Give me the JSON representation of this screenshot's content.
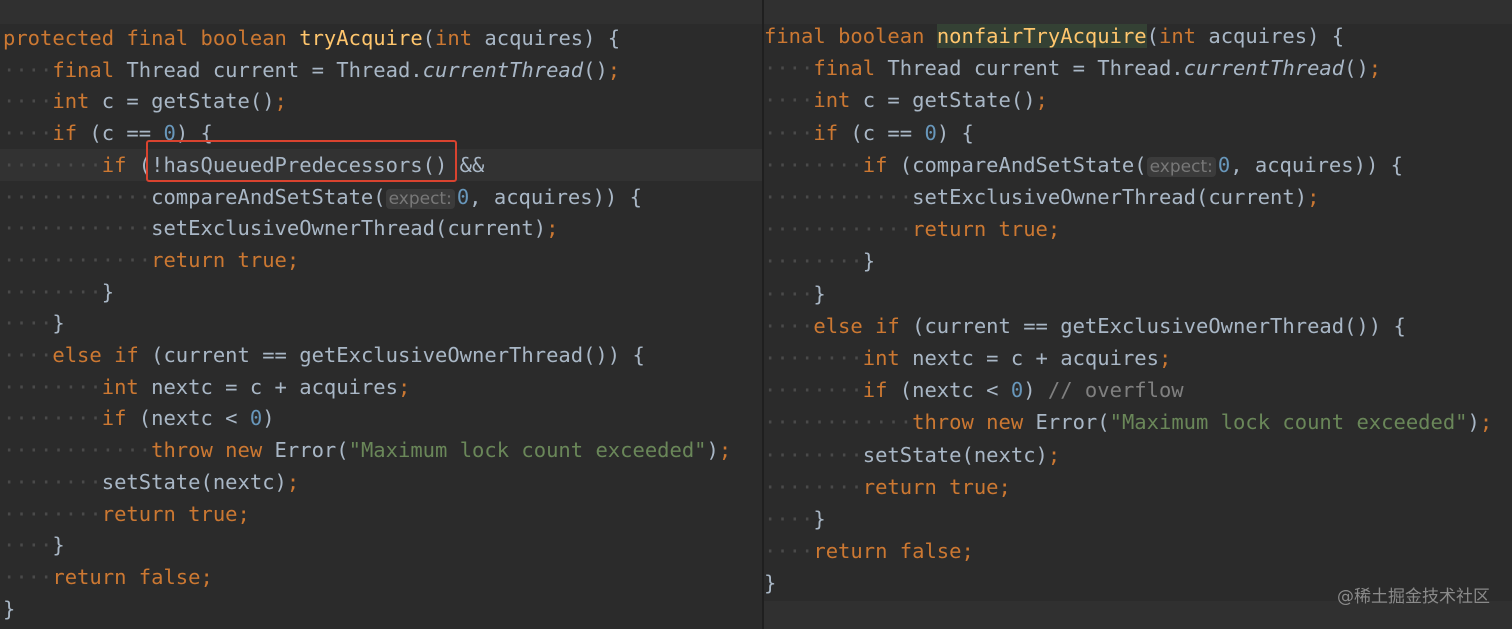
{
  "left_pane": {
    "lines": [
      {
        "ind": "",
        "tokens": [
          {
            "t": "protected",
            "c": "kw"
          },
          {
            "t": " "
          },
          {
            "t": "final",
            "c": "kw"
          },
          {
            "t": " "
          },
          {
            "t": "boolean",
            "c": "kw"
          },
          {
            "t": " "
          },
          {
            "t": "tryAcquire",
            "c": "fn"
          },
          {
            "t": "("
          },
          {
            "t": "int",
            "c": "kw"
          },
          {
            "t": " acquires) {"
          }
        ]
      },
      {
        "ind": "····",
        "tokens": [
          {
            "t": "final",
            "c": "kw"
          },
          {
            "t": " Thread current = Thread."
          },
          {
            "t": "currentThread",
            "c": "it"
          },
          {
            "t": "()"
          },
          {
            "t": ";",
            "c": "kw"
          }
        ]
      },
      {
        "ind": "····",
        "tokens": [
          {
            "t": "int",
            "c": "kw"
          },
          {
            "t": " c = getState()"
          },
          {
            "t": ";",
            "c": "kw"
          }
        ]
      },
      {
        "ind": "····",
        "tokens": [
          {
            "t": "if",
            "c": "kw"
          },
          {
            "t": " (c == "
          },
          {
            "t": "0",
            "c": "num"
          },
          {
            "t": ") {"
          }
        ]
      },
      {
        "ind": "········",
        "hl": true,
        "tokens": [
          {
            "t": "if",
            "c": "kw"
          },
          {
            "t": " ("
          },
          {
            "t": "!hasQueuedPredecessors"
          },
          {
            "t": "() &&"
          }
        ]
      },
      {
        "ind": "············",
        "tokens": [
          {
            "t": "compareAndSetState("
          },
          {
            "t": "expect:",
            "c": "hint"
          },
          {
            "t": "0",
            "c": "num"
          },
          {
            "t": ", acquires)) {"
          }
        ]
      },
      {
        "ind": "············",
        "tokens": [
          {
            "t": "setExclusiveOwnerThread(current)"
          },
          {
            "t": ";",
            "c": "kw"
          }
        ]
      },
      {
        "ind": "············",
        "tokens": [
          {
            "t": "return",
            "c": "kw"
          },
          {
            "t": " "
          },
          {
            "t": "true",
            "c": "kw"
          },
          {
            "t": ";",
            "c": "kw"
          }
        ]
      },
      {
        "ind": "········",
        "tokens": [
          {
            "t": "}"
          }
        ]
      },
      {
        "ind": "····",
        "tokens": [
          {
            "t": "}"
          }
        ]
      },
      {
        "ind": "····",
        "tokens": [
          {
            "t": "else",
            "c": "kw"
          },
          {
            "t": " "
          },
          {
            "t": "if",
            "c": "kw"
          },
          {
            "t": " (current == getExclusiveOwnerThread()) {"
          }
        ]
      },
      {
        "ind": "········",
        "tokens": [
          {
            "t": "int",
            "c": "kw"
          },
          {
            "t": " nextc = c + acquires"
          },
          {
            "t": ";",
            "c": "kw"
          }
        ]
      },
      {
        "ind": "········",
        "tokens": [
          {
            "t": "if",
            "c": "kw"
          },
          {
            "t": " (nextc < "
          },
          {
            "t": "0",
            "c": "num"
          },
          {
            "t": ")"
          }
        ]
      },
      {
        "ind": "············",
        "tokens": [
          {
            "t": "throw",
            "c": "kw"
          },
          {
            "t": " "
          },
          {
            "t": "new",
            "c": "kw"
          },
          {
            "t": " Error("
          },
          {
            "t": "\"Maximum lock count exceeded\"",
            "c": "str"
          },
          {
            "t": ")"
          },
          {
            "t": ";",
            "c": "kw"
          }
        ]
      },
      {
        "ind": "········",
        "tokens": [
          {
            "t": "setState(nextc)"
          },
          {
            "t": ";",
            "c": "kw"
          }
        ]
      },
      {
        "ind": "········",
        "tokens": [
          {
            "t": "return",
            "c": "kw"
          },
          {
            "t": " "
          },
          {
            "t": "true",
            "c": "kw"
          },
          {
            "t": ";",
            "c": "kw"
          }
        ]
      },
      {
        "ind": "····",
        "tokens": [
          {
            "t": "}"
          }
        ]
      },
      {
        "ind": "····",
        "tokens": [
          {
            "t": "return",
            "c": "kw"
          },
          {
            "t": " "
          },
          {
            "t": "false",
            "c": "kw"
          },
          {
            "t": ";",
            "c": "kw"
          }
        ]
      },
      {
        "ind": "",
        "tokens": [
          {
            "t": "}"
          }
        ]
      }
    ]
  },
  "right_pane": {
    "lines": [
      {
        "ind": "",
        "tokens": [
          {
            "t": "final",
            "c": "kw"
          },
          {
            "t": " "
          },
          {
            "t": "boolean",
            "c": "kw"
          },
          {
            "t": " "
          },
          {
            "t": "nonfairTryAcquire",
            "c": "fnhl"
          },
          {
            "t": "("
          },
          {
            "t": "int",
            "c": "kw"
          },
          {
            "t": " acquires) {"
          }
        ]
      },
      {
        "ind": "····",
        "tokens": [
          {
            "t": "final",
            "c": "kw"
          },
          {
            "t": " Thread current = Thread."
          },
          {
            "t": "currentThread",
            "c": "it"
          },
          {
            "t": "()"
          },
          {
            "t": ";",
            "c": "kw"
          }
        ]
      },
      {
        "ind": "····",
        "tokens": [
          {
            "t": "int",
            "c": "kw"
          },
          {
            "t": " c = getState()"
          },
          {
            "t": ";",
            "c": "kw"
          }
        ]
      },
      {
        "ind": "····",
        "tokens": [
          {
            "t": "if",
            "c": "kw"
          },
          {
            "t": " (c == "
          },
          {
            "t": "0",
            "c": "num"
          },
          {
            "t": ") {"
          }
        ]
      },
      {
        "ind": "········",
        "tokens": [
          {
            "t": "if",
            "c": "kw"
          },
          {
            "t": " (compareAndSetState("
          },
          {
            "t": "expect:",
            "c": "hint"
          },
          {
            "t": "0",
            "c": "num"
          },
          {
            "t": ", acquires)) {"
          }
        ]
      },
      {
        "ind": "············",
        "tokens": [
          {
            "t": "setExclusiveOwnerThread(current)"
          },
          {
            "t": ";",
            "c": "kw"
          }
        ]
      },
      {
        "ind": "············",
        "tokens": [
          {
            "t": "return",
            "c": "kw"
          },
          {
            "t": " "
          },
          {
            "t": "true",
            "c": "kw"
          },
          {
            "t": ";",
            "c": "kw"
          }
        ]
      },
      {
        "ind": "········",
        "tokens": [
          {
            "t": "}"
          }
        ]
      },
      {
        "ind": "····",
        "tokens": [
          {
            "t": "}"
          }
        ]
      },
      {
        "ind": "····",
        "tokens": [
          {
            "t": "else",
            "c": "kw"
          },
          {
            "t": " "
          },
          {
            "t": "if",
            "c": "kw"
          },
          {
            "t": " (current == getExclusiveOwnerThread()) {"
          }
        ]
      },
      {
        "ind": "········",
        "tokens": [
          {
            "t": "int",
            "c": "kw"
          },
          {
            "t": " nextc = c + acquires"
          },
          {
            "t": ";",
            "c": "kw"
          }
        ]
      },
      {
        "ind": "········",
        "tokens": [
          {
            "t": "if",
            "c": "kw"
          },
          {
            "t": " (nextc < "
          },
          {
            "t": "0",
            "c": "num"
          },
          {
            "t": ") "
          },
          {
            "t": "// overflow",
            "c": "cm"
          }
        ]
      },
      {
        "ind": "············",
        "tokens": [
          {
            "t": "throw",
            "c": "kw"
          },
          {
            "t": " "
          },
          {
            "t": "new",
            "c": "kw"
          },
          {
            "t": " Error("
          },
          {
            "t": "\"Maximum lock count exceeded\"",
            "c": "str"
          },
          {
            "t": ")"
          },
          {
            "t": ";",
            "c": "kw"
          }
        ]
      },
      {
        "ind": "········",
        "tokens": [
          {
            "t": "setState(nextc)"
          },
          {
            "t": ";",
            "c": "kw"
          }
        ]
      },
      {
        "ind": "········",
        "tokens": [
          {
            "t": "return",
            "c": "kw"
          },
          {
            "t": " "
          },
          {
            "t": "true",
            "c": "kw"
          },
          {
            "t": ";",
            "c": "kw"
          }
        ]
      },
      {
        "ind": "····",
        "tokens": [
          {
            "t": "}"
          }
        ]
      },
      {
        "ind": "····",
        "tokens": [
          {
            "t": "return",
            "c": "kw"
          },
          {
            "t": " "
          },
          {
            "t": "false",
            "c": "kw"
          },
          {
            "t": ";",
            "c": "kw"
          }
        ]
      },
      {
        "ind": "",
        "tokens": [
          {
            "t": "}"
          }
        ]
      }
    ]
  },
  "watermark": "@稀土掘金技术社区",
  "colors": {
    "background": "#2b2b2b",
    "keyword": "#cc7832",
    "method": "#ffc66d",
    "number": "#6897bb",
    "string": "#6a8759",
    "comment": "#808080",
    "highlight_box": "#d9432f"
  }
}
